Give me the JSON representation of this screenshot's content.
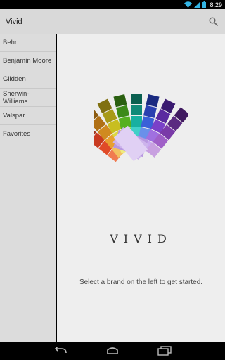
{
  "status_bar": {
    "time": "8:29"
  },
  "app": {
    "title": "Vivid"
  },
  "sidebar": {
    "items": [
      {
        "label": "Behr"
      },
      {
        "label": "Benjamin Moore"
      },
      {
        "label": "Glidden"
      },
      {
        "label": "Sherwin-Williams"
      },
      {
        "label": "Valspar"
      },
      {
        "label": "Favorites"
      }
    ]
  },
  "main": {
    "brand_word": "VIVID",
    "prompt": "Select a brand on the left to get started."
  },
  "colors": {
    "action_bar": "#d9d9d9",
    "sidebar": "#dcdcdc",
    "content": "#eeeeee",
    "status_accent": "#33b5e5"
  },
  "icons": {
    "search": "search-icon",
    "back": "back-icon",
    "home": "home-icon",
    "recents": "recents-icon",
    "wifi": "wifi-icon",
    "signal": "signal-icon",
    "battery": "battery-icon"
  }
}
